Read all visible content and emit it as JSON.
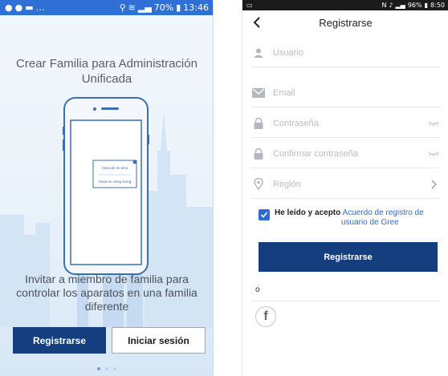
{
  "left_screen": {
    "status_bar": {
      "icons_left": "notifications",
      "signal_label": "70%",
      "time": "13:46"
    },
    "headline": "Crear Familia para Administración Unificada",
    "illustration": {
      "house_name_1": "Casa de mi amo",
      "house_name_2": "Casa en Hong Kong"
    },
    "invite_text": "Invitar a miembro de familia para controlar los aparatos en una familia diferente",
    "register_label": "Registrarse",
    "login_label": "Iniciar sesión",
    "pager": {
      "count": 3,
      "active": 0
    }
  },
  "right_screen": {
    "status_bar": {
      "battery": "96%",
      "time": "8:50"
    },
    "title": "Registrarse",
    "fields": {
      "username_placeholder": "Usuario",
      "email_placeholder": "Email",
      "password_placeholder": "Contraseña",
      "confirm_placeholder": "Confirmar contraseña",
      "region_placeholder": "Región"
    },
    "agreement": {
      "checked": true,
      "label": "He leído y acepto",
      "link_part1": "Acuerdo de registro de",
      "link_part2": "usuario de Gree"
    },
    "register_label": "Registrarse",
    "or_label": "o",
    "social": [
      {
        "icon": "facebook-icon"
      }
    ]
  },
  "colors": {
    "primary": "#143e7e",
    "accent": "#2f6bd6",
    "status_bar_left": "#2f6fd6",
    "status_bar_right": "#1b1b1b"
  }
}
